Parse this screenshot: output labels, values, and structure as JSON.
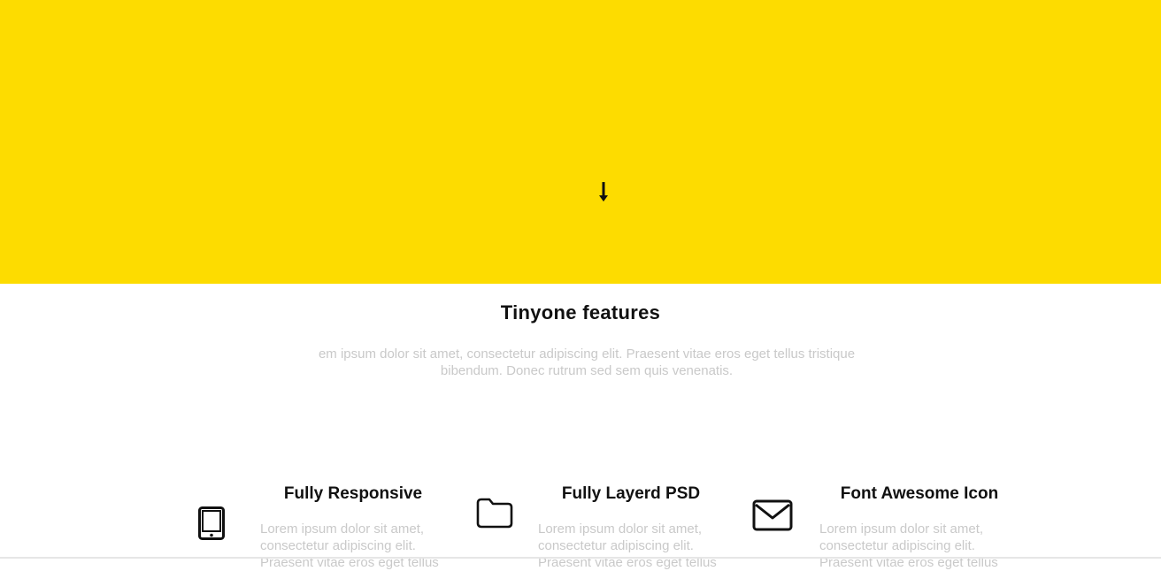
{
  "colors": {
    "hero_background": "#FDDC00",
    "title_text": "#111111",
    "muted_text": "#c9c9c9"
  },
  "hero": {
    "scroll_icon": "arrow-down-icon"
  },
  "features_section": {
    "title": "Tinyone features",
    "intro": "em ipsum dolor sit amet, consectetur adipiscing elit. Praesent vitae eros eget tellus tristique bibendum. Donec rutrum sed sem quis venenatis.",
    "items": [
      {
        "icon": "tablet-icon",
        "title": "Fully Responsive",
        "text": "Lorem ipsum dolor sit amet, consectetur adipiscing elit. Praesent vitae eros eget tellus"
      },
      {
        "icon": "folder-icon",
        "title": "Fully Layerd PSD",
        "text": "Lorem ipsum dolor sit amet, consectetur adipiscing elit. Praesent vitae eros eget tellus"
      },
      {
        "icon": "envelope-icon",
        "title": "Font Awesome Icon",
        "text": "Lorem ipsum dolor sit amet, consectetur adipiscing elit. Praesent vitae eros eget tellus"
      }
    ]
  }
}
